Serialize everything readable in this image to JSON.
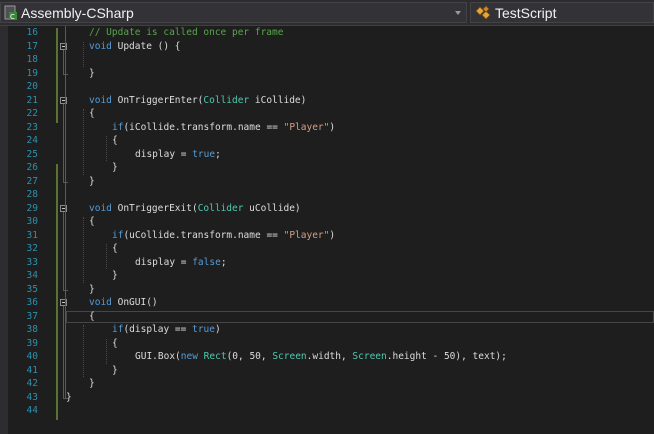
{
  "topbar": {
    "project_dropdown": "Assembly-CSharp",
    "class_dropdown": "TestScript"
  },
  "editor": {
    "lines": [
      {
        "n": "16",
        "tokens": [
          {
            "t": "// Update is called once per frame",
            "c": "cm"
          }
        ],
        "indent": 1
      },
      {
        "n": "17",
        "tokens": [
          {
            "t": "void",
            "c": "kw"
          },
          {
            "t": " Update () {",
            "c": ""
          }
        ],
        "indent": 1
      },
      {
        "n": "18",
        "tokens": [],
        "indent": 0
      },
      {
        "n": "19",
        "tokens": [
          {
            "t": "}",
            "c": ""
          }
        ],
        "indent": 1
      },
      {
        "n": "20",
        "tokens": [],
        "indent": 0
      },
      {
        "n": "21",
        "tokens": [
          {
            "t": "void",
            "c": "kw"
          },
          {
            "t": " OnTriggerEnter(",
            "c": ""
          },
          {
            "t": "Collider",
            "c": "ty"
          },
          {
            "t": " iCollide)",
            "c": ""
          }
        ],
        "indent": 1
      },
      {
        "n": "22",
        "tokens": [
          {
            "t": "{",
            "c": ""
          }
        ],
        "indent": 1
      },
      {
        "n": "23",
        "tokens": [
          {
            "t": "if",
            "c": "kw"
          },
          {
            "t": "(iCollide.transform.name == ",
            "c": ""
          },
          {
            "t": "\"Player\"",
            "c": "str"
          },
          {
            "t": ")",
            "c": ""
          }
        ],
        "indent": 2
      },
      {
        "n": "24",
        "tokens": [
          {
            "t": "{",
            "c": ""
          }
        ],
        "indent": 2
      },
      {
        "n": "25",
        "tokens": [
          {
            "t": "display = ",
            "c": ""
          },
          {
            "t": "true",
            "c": "kw"
          },
          {
            "t": ";",
            "c": ""
          }
        ],
        "indent": 3
      },
      {
        "n": "26",
        "tokens": [
          {
            "t": "}",
            "c": ""
          }
        ],
        "indent": 2
      },
      {
        "n": "27",
        "tokens": [
          {
            "t": "}",
            "c": ""
          }
        ],
        "indent": 1
      },
      {
        "n": "28",
        "tokens": [],
        "indent": 0
      },
      {
        "n": "29",
        "tokens": [
          {
            "t": "void",
            "c": "kw"
          },
          {
            "t": " OnTriggerExit(",
            "c": ""
          },
          {
            "t": "Collider",
            "c": "ty"
          },
          {
            "t": " uCollide)",
            "c": ""
          }
        ],
        "indent": 1
      },
      {
        "n": "30",
        "tokens": [
          {
            "t": "{",
            "c": ""
          }
        ],
        "indent": 1
      },
      {
        "n": "31",
        "tokens": [
          {
            "t": "if",
            "c": "kw"
          },
          {
            "t": "(uCollide.transform.name == ",
            "c": ""
          },
          {
            "t": "\"Player\"",
            "c": "str"
          },
          {
            "t": ")",
            "c": ""
          }
        ],
        "indent": 2
      },
      {
        "n": "32",
        "tokens": [
          {
            "t": "{",
            "c": ""
          }
        ],
        "indent": 2
      },
      {
        "n": "33",
        "tokens": [
          {
            "t": "display = ",
            "c": ""
          },
          {
            "t": "false",
            "c": "kw"
          },
          {
            "t": ";",
            "c": ""
          }
        ],
        "indent": 3
      },
      {
        "n": "34",
        "tokens": [
          {
            "t": "}",
            "c": ""
          }
        ],
        "indent": 2
      },
      {
        "n": "35",
        "tokens": [
          {
            "t": "}",
            "c": ""
          }
        ],
        "indent": 1
      },
      {
        "n": "36",
        "tokens": [
          {
            "t": "void",
            "c": "kw"
          },
          {
            "t": " OnGUI()",
            "c": ""
          }
        ],
        "indent": 1
      },
      {
        "n": "37",
        "tokens": [
          {
            "t": "{",
            "c": ""
          }
        ],
        "indent": 1
      },
      {
        "n": "38",
        "tokens": [
          {
            "t": "if",
            "c": "kw"
          },
          {
            "t": "(display == ",
            "c": ""
          },
          {
            "t": "true",
            "c": "kw"
          },
          {
            "t": ")",
            "c": ""
          }
        ],
        "indent": 2
      },
      {
        "n": "39",
        "tokens": [
          {
            "t": "{",
            "c": ""
          }
        ],
        "indent": 2
      },
      {
        "n": "40",
        "tokens": [
          {
            "t": "GUI.Box(",
            "c": ""
          },
          {
            "t": "new",
            "c": "kw"
          },
          {
            "t": " ",
            "c": ""
          },
          {
            "t": "Rect",
            "c": "ty"
          },
          {
            "t": "(0, 50, ",
            "c": ""
          },
          {
            "t": "Screen",
            "c": "ty"
          },
          {
            "t": ".width, ",
            "c": ""
          },
          {
            "t": "Screen",
            "c": "ty"
          },
          {
            "t": ".height - 50), text);",
            "c": ""
          }
        ],
        "indent": 3
      },
      {
        "n": "41",
        "tokens": [
          {
            "t": "}",
            "c": ""
          }
        ],
        "indent": 2
      },
      {
        "n": "42",
        "tokens": [
          {
            "t": "}",
            "c": ""
          }
        ],
        "indent": 1
      },
      {
        "n": "43",
        "tokens": [
          {
            "t": "}",
            "c": ""
          }
        ],
        "indent": 0
      },
      {
        "n": "44",
        "tokens": [],
        "indent": 0
      }
    ],
    "current_line": "37"
  },
  "colors": {
    "keyword": "#569cd6",
    "type": "#4ec9b0",
    "string": "#d69d85",
    "comment": "#57a64a",
    "line_number": "#2b91af",
    "text": "#dcdcdc",
    "background": "#1e1e1e"
  },
  "icons": {
    "project": "csharp-project-icon",
    "class": "class-icon",
    "dropdown": "chevron-down-icon"
  }
}
